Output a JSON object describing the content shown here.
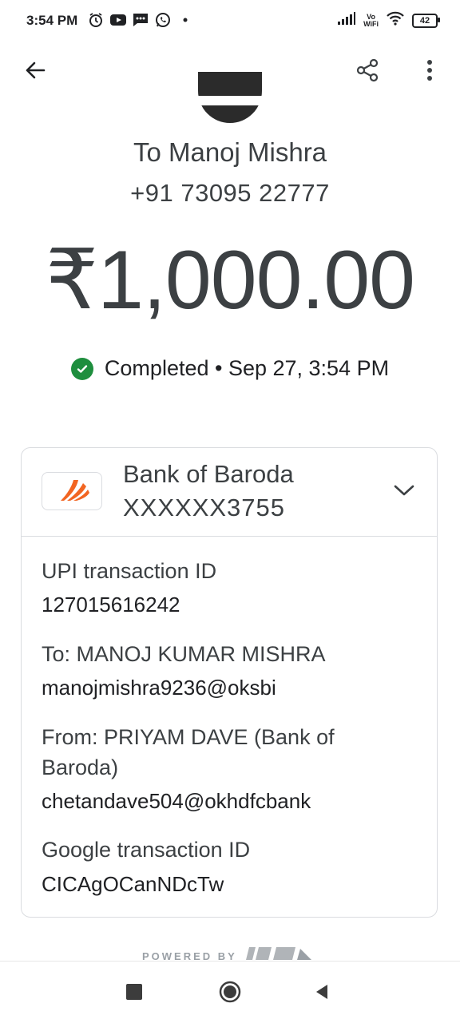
{
  "status_bar": {
    "time": "3:54 PM",
    "vowifi_top": "Vo",
    "vowifi_bottom": "WiFi",
    "battery": "42"
  },
  "recipient": {
    "name": "To Manoj Mishra",
    "phone": "+91 73095 22777"
  },
  "amount": "₹1,000.00",
  "status": {
    "text": "Completed • Sep 27, 3:54 PM",
    "color": "#1e8e3e"
  },
  "bank": {
    "name": "Bank of Baroda",
    "account": "XXXXXX3755",
    "brand_color": "#f26522"
  },
  "details": {
    "upi_label": "UPI transaction ID",
    "upi_value": "127015616242",
    "to_label": "To: MANOJ KUMAR  MISHRA",
    "to_value": "manojmishra9236@oksbi",
    "from_label_line1": "From: PRIYAM DAVE (Bank of",
    "from_label_line2": "Baroda)",
    "from_value": "chetandave504@okhdfcbank",
    "google_label": "Google transaction ID",
    "google_value": "CICAgOCanNDcTw"
  },
  "footer": {
    "powered_by": "POWERED BY",
    "upi_logo": "UPI"
  },
  "icons": {
    "back": "arrow-left-icon",
    "share": "share-icon",
    "more": "more-vert-icon",
    "expand": "chevron-down-icon",
    "check": "check-circle-icon"
  }
}
